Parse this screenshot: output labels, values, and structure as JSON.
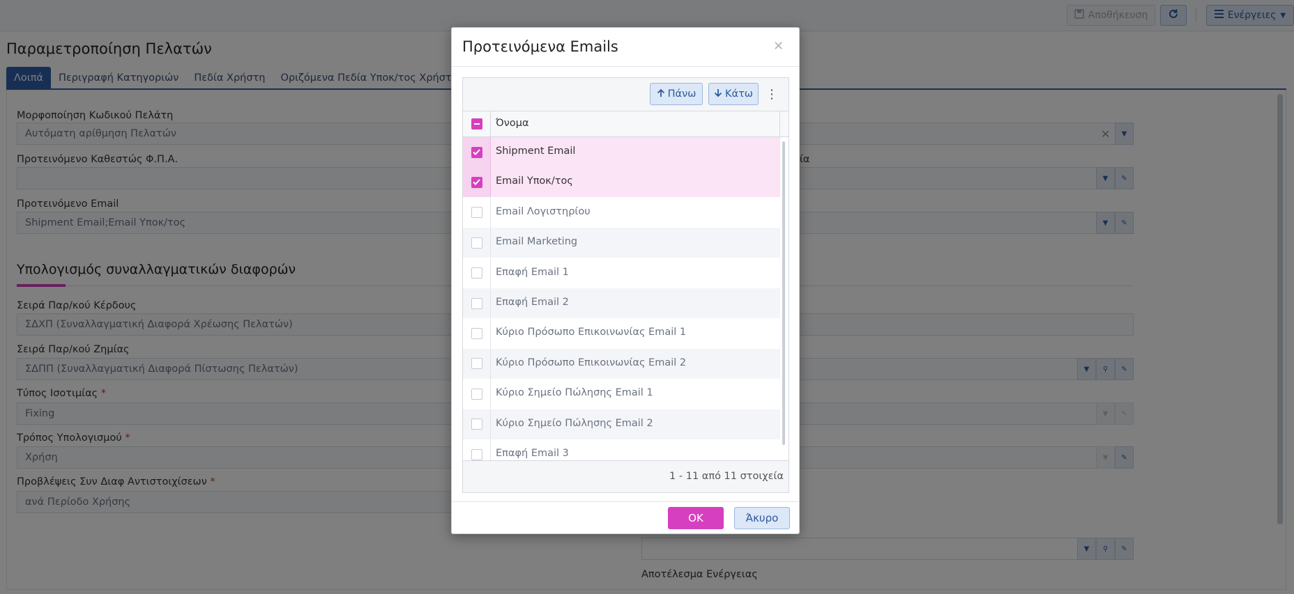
{
  "toolbar": {
    "save_label": "Αποθήκευση",
    "actions_label": "Ενέργειες"
  },
  "page": {
    "title": "Παραμετροποίηση Πελατών",
    "tabs": [
      "Λοιπά",
      "Περιγραφή Κατηγοριών",
      "Πεδία Χρήστη",
      "Οριζόμενα Πεδία Υποκ/τος Χρήστη"
    ],
    "fields": {
      "customer_code_format": {
        "label": "Μορφοποίηση Κωδικού Πελάτη",
        "value": "Αυτόματη αρίθμηση Πελατών"
      },
      "vat_status": {
        "label": "Προτεινόμενο Καθεστώς Φ.Π.Α.",
        "value": ""
      },
      "suggested_email": {
        "label": "Προτεινόμενο Email",
        "value": "Shipment Email;Email Υποκ/τος"
      },
      "right_label_partial": "ία",
      "profit_series": {
        "label": "Σειρά Παρ/κού Κέρδους",
        "value": "ΣΔΧΠ (Συναλλαγματική Διαφορά Χρέωσης Πελατών)"
      },
      "loss_series": {
        "label": "Σειρά Παρ/κού Ζημίας",
        "value": "ΣΔΠΠ (Συναλλαγματική Διαφορά Πίστωσης Πελατών)"
      },
      "rate_type": {
        "label": "Τύπος Ισοτιμίας",
        "value": "Fixing"
      },
      "calc_method": {
        "label": "Τρόπος Υπολογισμού",
        "value": "Χρήση"
      },
      "provisions": {
        "label": "Προβλέψεις Συν Διαφ Αντιστοιχίσεων",
        "value": "ανά Περίοδο Χρήσης"
      },
      "action_result": {
        "label": "Αποτέλεσμα Ενέργειας"
      }
    },
    "section_title": "Υπολογισμός συναλλαγματικών διαφορών"
  },
  "modal": {
    "title": "Προτεινόμενα Emails",
    "up_label": "Πάνω",
    "down_label": "Κάτω",
    "column_name": "Όνομα",
    "rows": [
      {
        "name": "Shipment Email",
        "checked": true
      },
      {
        "name": "Email Υποκ/τος",
        "checked": true
      },
      {
        "name": "Email Λογιστηρίου",
        "checked": false
      },
      {
        "name": "Email Marketing",
        "checked": false
      },
      {
        "name": "Επαφή Email 1",
        "checked": false
      },
      {
        "name": "Επαφή Email 2",
        "checked": false
      },
      {
        "name": "Κύριο Πρόσωπο Επικοινωνίας Email 1",
        "checked": false
      },
      {
        "name": "Κύριο Πρόσωπο Επικοινωνίας Email 2",
        "checked": false
      },
      {
        "name": "Κύριο Σημείο Πώλησης Email 1",
        "checked": false
      },
      {
        "name": "Κύριο Σημείο Πώλησης Email 2",
        "checked": false
      },
      {
        "name": "Επαφή Email 3",
        "checked": false
      }
    ],
    "pager_text": "1 - 11 από 11 στοιχεία",
    "ok_label": "OK",
    "cancel_label": "Άκυρο"
  }
}
